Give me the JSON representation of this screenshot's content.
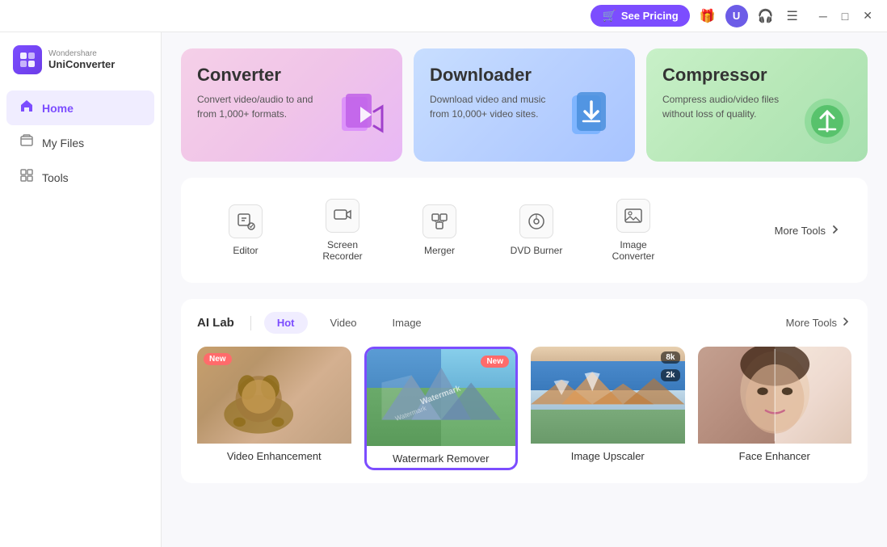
{
  "titlebar": {
    "pricing_label": "See Pricing",
    "minimize_label": "─",
    "maximize_label": "□",
    "close_label": "✕",
    "hamburger_label": "☰"
  },
  "logo": {
    "brand": "Wondershare",
    "name": "UniConverter"
  },
  "sidebar": {
    "items": [
      {
        "id": "home",
        "label": "Home",
        "icon": "🏠",
        "active": true
      },
      {
        "id": "my-files",
        "label": "My Files",
        "icon": "📁",
        "active": false
      },
      {
        "id": "tools",
        "label": "Tools",
        "icon": "🧰",
        "active": false
      }
    ]
  },
  "hero_cards": [
    {
      "id": "converter",
      "title": "Converter",
      "desc": "Convert video/audio to and from 1,000+ formats.",
      "theme": "converter"
    },
    {
      "id": "downloader",
      "title": "Downloader",
      "desc": "Download video and music from 10,000+ video sites.",
      "theme": "downloader"
    },
    {
      "id": "compressor",
      "title": "Compressor",
      "desc": "Compress audio/video files without loss of quality.",
      "theme": "compressor"
    }
  ],
  "tools": {
    "items": [
      {
        "id": "editor",
        "label": "Editor",
        "icon": "✂"
      },
      {
        "id": "screen-recorder",
        "label": "Screen Recorder",
        "icon": "📹"
      },
      {
        "id": "merger",
        "label": "Merger",
        "icon": "⊕"
      },
      {
        "id": "dvd-burner",
        "label": "DVD Burner",
        "icon": "💿"
      },
      {
        "id": "image-converter",
        "label": "Image Converter",
        "icon": "🖼"
      }
    ],
    "more_label": "More Tools"
  },
  "ai_lab": {
    "section_title": "AI Lab",
    "tabs": [
      {
        "id": "hot",
        "label": "Hot",
        "active": true
      },
      {
        "id": "video",
        "label": "Video",
        "active": false
      },
      {
        "id": "image",
        "label": "Image",
        "active": false
      }
    ],
    "more_label": "More Tools",
    "cards": [
      {
        "id": "video-enhancement",
        "label": "Video Enhancement",
        "is_new": true,
        "new_position": "left",
        "selected": false,
        "theme": "animal"
      },
      {
        "id": "watermark-remover",
        "label": "Watermark Remover",
        "is_new": true,
        "new_position": "right",
        "selected": true,
        "theme": "mountain"
      },
      {
        "id": "image-upscaler",
        "label": "Image Upscaler",
        "is_new": false,
        "badge": "8k",
        "badge2": "2k",
        "selected": false,
        "theme": "norway"
      },
      {
        "id": "face-enhancer",
        "label": "Face Enhancer",
        "is_new": false,
        "selected": false,
        "theme": "face"
      }
    ]
  }
}
